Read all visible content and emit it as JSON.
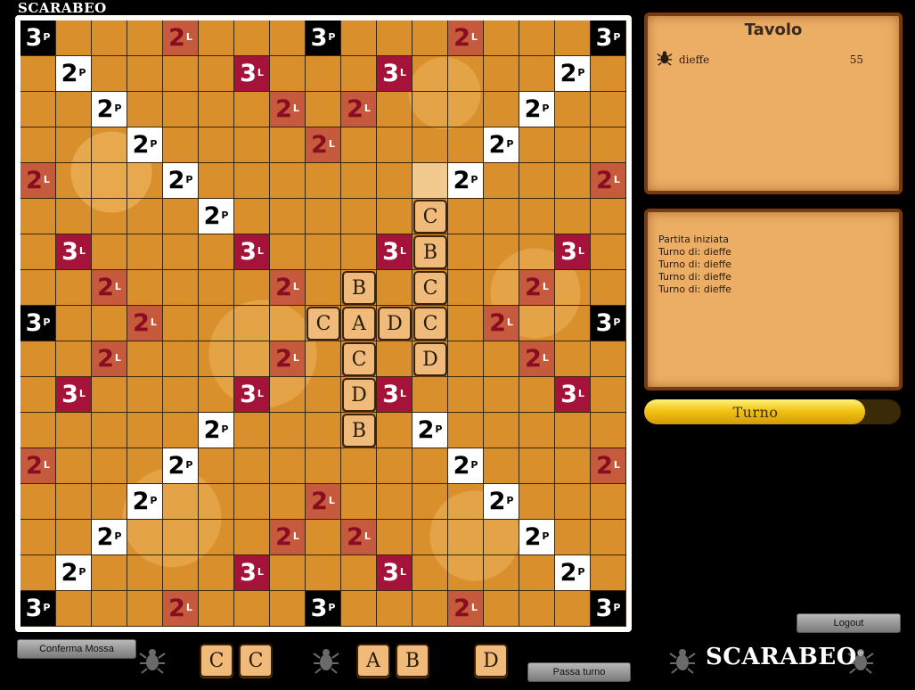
{
  "app": {
    "logo_top": "SCARABEO",
    "logo_bottom": "SCARABEO",
    "logo_bottom_mark": "®"
  },
  "board": {
    "size": 17,
    "colors": {
      "board": "#d98f2c",
      "grid": "#3a2408",
      "tile": "#f0bb7a",
      "highlight": "#f2c98f"
    },
    "bonus_legend": {
      "3P": {
        "num": "3",
        "sub": "P",
        "color": "#000000"
      },
      "2P": {
        "num": "2",
        "sub": "P",
        "color": "#ffffff"
      },
      "3L": {
        "num": "3",
        "sub": "L",
        "color": "#a5123a"
      },
      "2L": {
        "num": "2",
        "sub": "L",
        "color": "#c65a3c"
      }
    },
    "bonus_cells": [
      {
        "r": 0,
        "c": 0,
        "t": "3P"
      },
      {
        "r": 0,
        "c": 4,
        "t": "2L"
      },
      {
        "r": 0,
        "c": 8,
        "t": "3P"
      },
      {
        "r": 0,
        "c": 12,
        "t": "2L"
      },
      {
        "r": 0,
        "c": 16,
        "t": "3P"
      },
      {
        "r": 1,
        "c": 1,
        "t": "2P"
      },
      {
        "r": 1,
        "c": 6,
        "t": "3L"
      },
      {
        "r": 1,
        "c": 10,
        "t": "3L"
      },
      {
        "r": 1,
        "c": 15,
        "t": "2P"
      },
      {
        "r": 2,
        "c": 2,
        "t": "2P"
      },
      {
        "r": 2,
        "c": 7,
        "t": "2L"
      },
      {
        "r": 2,
        "c": 9,
        "t": "2L"
      },
      {
        "r": 2,
        "c": 14,
        "t": "2P"
      },
      {
        "r": 3,
        "c": 3,
        "t": "2P"
      },
      {
        "r": 3,
        "c": 8,
        "t": "2L"
      },
      {
        "r": 3,
        "c": 13,
        "t": "2P"
      },
      {
        "r": 4,
        "c": 0,
        "t": "2L"
      },
      {
        "r": 4,
        "c": 4,
        "t": "2P"
      },
      {
        "r": 4,
        "c": 12,
        "t": "2P"
      },
      {
        "r": 4,
        "c": 16,
        "t": "2L"
      },
      {
        "r": 5,
        "c": 5,
        "t": "2P"
      },
      {
        "r": 6,
        "c": 1,
        "t": "3L"
      },
      {
        "r": 6,
        "c": 6,
        "t": "3L"
      },
      {
        "r": 6,
        "c": 10,
        "t": "3L"
      },
      {
        "r": 6,
        "c": 15,
        "t": "3L"
      },
      {
        "r": 7,
        "c": 2,
        "t": "2L"
      },
      {
        "r": 7,
        "c": 7,
        "t": "2L"
      },
      {
        "r": 7,
        "c": 14,
        "t": "2L"
      },
      {
        "r": 8,
        "c": 0,
        "t": "3P"
      },
      {
        "r": 8,
        "c": 3,
        "t": "2L"
      },
      {
        "r": 8,
        "c": 13,
        "t": "2L"
      },
      {
        "r": 8,
        "c": 16,
        "t": "3P"
      },
      {
        "r": 9,
        "c": 2,
        "t": "2L"
      },
      {
        "r": 9,
        "c": 7,
        "t": "2L"
      },
      {
        "r": 9,
        "c": 14,
        "t": "2L"
      },
      {
        "r": 10,
        "c": 1,
        "t": "3L"
      },
      {
        "r": 10,
        "c": 6,
        "t": "3L"
      },
      {
        "r": 10,
        "c": 10,
        "t": "3L"
      },
      {
        "r": 10,
        "c": 15,
        "t": "3L"
      },
      {
        "r": 11,
        "c": 5,
        "t": "2P"
      },
      {
        "r": 11,
        "c": 11,
        "t": "2P"
      },
      {
        "r": 12,
        "c": 0,
        "t": "2L"
      },
      {
        "r": 12,
        "c": 4,
        "t": "2P"
      },
      {
        "r": 12,
        "c": 12,
        "t": "2P"
      },
      {
        "r": 12,
        "c": 16,
        "t": "2L"
      },
      {
        "r": 13,
        "c": 3,
        "t": "2P"
      },
      {
        "r": 13,
        "c": 8,
        "t": "2L"
      },
      {
        "r": 13,
        "c": 13,
        "t": "2P"
      },
      {
        "r": 14,
        "c": 2,
        "t": "2P"
      },
      {
        "r": 14,
        "c": 7,
        "t": "2L"
      },
      {
        "r": 14,
        "c": 9,
        "t": "2L"
      },
      {
        "r": 14,
        "c": 14,
        "t": "2P"
      },
      {
        "r": 15,
        "c": 1,
        "t": "2P"
      },
      {
        "r": 15,
        "c": 6,
        "t": "3L"
      },
      {
        "r": 15,
        "c": 10,
        "t": "3L"
      },
      {
        "r": 15,
        "c": 15,
        "t": "2P"
      },
      {
        "r": 16,
        "c": 0,
        "t": "3P"
      },
      {
        "r": 16,
        "c": 4,
        "t": "2L"
      },
      {
        "r": 16,
        "c": 8,
        "t": "3P"
      },
      {
        "r": 16,
        "c": 12,
        "t": "2L"
      },
      {
        "r": 16,
        "c": 16,
        "t": "3P"
      }
    ],
    "highlight_cells": [
      {
        "r": 4,
        "c": 11
      }
    ],
    "placed_tiles": [
      {
        "r": 5,
        "c": 11,
        "letter": "C"
      },
      {
        "r": 6,
        "c": 11,
        "letter": "B"
      },
      {
        "r": 7,
        "c": 9,
        "letter": "B"
      },
      {
        "r": 7,
        "c": 11,
        "letter": "C"
      },
      {
        "r": 8,
        "c": 8,
        "letter": "C"
      },
      {
        "r": 8,
        "c": 9,
        "letter": "A"
      },
      {
        "r": 8,
        "c": 10,
        "letter": "D"
      },
      {
        "r": 8,
        "c": 11,
        "letter": "C"
      },
      {
        "r": 9,
        "c": 9,
        "letter": "C"
      },
      {
        "r": 9,
        "c": 11,
        "letter": "D"
      },
      {
        "r": 10,
        "c": 9,
        "letter": "D"
      },
      {
        "r": 11,
        "c": 9,
        "letter": "B"
      }
    ]
  },
  "tavolo": {
    "title": "Tavolo",
    "players": [
      {
        "name": "dieffe",
        "score": "55",
        "icon": "scarab-icon"
      }
    ]
  },
  "log": {
    "entries": [
      "Partita iniziata",
      "Turno di: dieffe",
      "Turno di: dieffe",
      "Turno di: dieffe",
      "Turno di: dieffe"
    ]
  },
  "turn": {
    "label": "Turno",
    "progress": 0.86,
    "fill_color": "#f2c415"
  },
  "buttons": {
    "confirm": "Conferma Mossa",
    "pass": "Passa turno",
    "logout": "Logout"
  },
  "rack": [
    "C",
    "C",
    "A",
    "B",
    "D"
  ]
}
